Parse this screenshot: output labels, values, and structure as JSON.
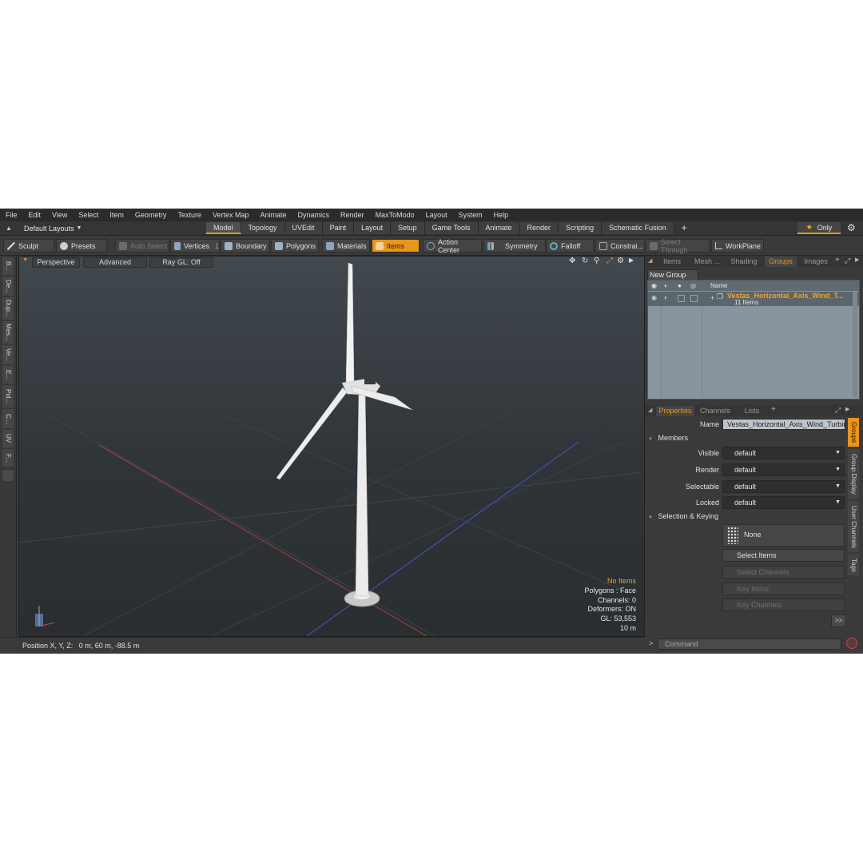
{
  "menu": [
    "File",
    "Edit",
    "View",
    "Select",
    "Item",
    "Geometry",
    "Texture",
    "Vertex Map",
    "Animate",
    "Dynamics",
    "Render",
    "MaxToModo",
    "Layout",
    "System",
    "Help"
  ],
  "layout_selector": "Default Layouts",
  "tabs": [
    "Model",
    "Topology",
    "UVEdit",
    "Paint",
    "Layout",
    "Setup",
    "Game Tools",
    "Animate",
    "Render",
    "Scripting",
    "Schematic Fusion"
  ],
  "active_tab": "Model",
  "only_label": "Only",
  "toolbar": {
    "sculpt": "Sculpt",
    "presets": "Presets",
    "auto_select": "Auto Select",
    "vertices": "Vertices",
    "vertices_count": "1",
    "boundary": "Boundary",
    "polygons": "Polygons",
    "materials": "Materials",
    "items": "Items",
    "action_center": "Action Center",
    "symmetry": "Symmetry",
    "falloff": "Falloff",
    "constraints": "Constrai...",
    "select_through": "Select Through",
    "workplane": "WorkPlane"
  },
  "left_tabs": [
    "B...",
    "De...",
    "Dup...",
    "Mes...",
    "Ve...",
    "E...",
    "Pol...",
    "C...",
    "UV",
    "F..."
  ],
  "viewport": {
    "view": "Perspective",
    "shading": "Advanced",
    "raygl": "Ray GL: Off",
    "stats": {
      "selection": "No Items",
      "polygons": "Polygons : Face",
      "channels": "Channels: 0",
      "deformers": "Deformers: ON",
      "gl": "GL: 53,553",
      "scale": "10 m"
    }
  },
  "status": {
    "position": "Position X, Y, Z:   0 m, 60 m, -88.5 m"
  },
  "right_top_tabs": [
    "Items",
    "Mesh ...",
    "Shading",
    "Groups",
    "Images"
  ],
  "right_top_active": "Groups",
  "new_group": "New Group",
  "groups_header_name": "Name",
  "group": {
    "name": "Vestas_Horizontal_Axis_Wind_T...",
    "count": "11 Items"
  },
  "prop_tabs": [
    "Properties",
    "Channels",
    "Lists"
  ],
  "prop_active": "Properties",
  "properties": {
    "name_label": "Name",
    "name_value": "Vestas_Horizontal_Axis_Wind_Turbine",
    "members_section": "Members",
    "rows": [
      {
        "label": "Visible",
        "value": "default"
      },
      {
        "label": "Render",
        "value": "default"
      },
      {
        "label": "Selectable",
        "value": "default"
      },
      {
        "label": "Locked",
        "value": "default"
      }
    ],
    "keying_section": "Selection & Keying",
    "none_label": "None",
    "select_items": "Select Items",
    "select_channels": "Select Channels",
    "key_items": "Key Items",
    "key_channels": "Key Channels",
    "more": ">>"
  },
  "side_vtabs": [
    "Groups",
    "Group Display",
    "User Channels",
    "Tags"
  ],
  "command_placeholder": "Command",
  "colors": {
    "accent": "#e8951c",
    "x_axis": "#b84a3c",
    "z_axis": "#4a54b8"
  }
}
